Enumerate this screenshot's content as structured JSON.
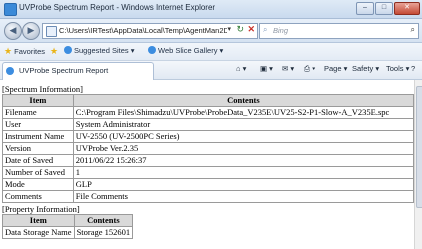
{
  "window": {
    "title": "UVProbe Spectrum Report - Windows Internet Explorer",
    "min_label": "–",
    "max_label": "□",
    "close_label": "✕"
  },
  "address": {
    "url": "C:\\Users\\IRTest\\AppData\\Local\\Temp\\AgentMan2D",
    "search_placeholder": "Bing"
  },
  "favorites_bar": {
    "favorites_label": "Favorites",
    "suggested_sites_label": "Suggested Sites ▾",
    "web_slice_label": "Web Slice Gallery ▾"
  },
  "tab": {
    "label": "UVProbe Spectrum Report"
  },
  "commands": {
    "page_label": "Page ▾",
    "safety_label": "Safety ▾",
    "tools_label": "Tools ▾"
  },
  "spectrum_info": {
    "section_title": "[Spectrum Information]",
    "headers": [
      "Item",
      "Contents"
    ],
    "rows": [
      [
        "Filename",
        "C:\\Program Files\\Shimadzu\\UVProbe\\ProbeData_V235E\\UV25-S2-P1-Slow-A_V235E.spc"
      ],
      [
        "User",
        "System Administrator"
      ],
      [
        "Instrument Name",
        "UV-2550 (UV-2500PC Series)"
      ],
      [
        "Version",
        "UVProbe Ver.2.35"
      ],
      [
        "Date of Saved",
        "2011/06/22 15:26:37"
      ],
      [
        "Number of Saved",
        "1"
      ],
      [
        "Mode",
        "GLP"
      ],
      [
        "Comments",
        "File Comments"
      ]
    ]
  },
  "property_info": {
    "section_title": "[Property Information]",
    "headers": [
      "Item",
      "Contents"
    ],
    "rows": [
      [
        "Data Storage Name",
        "Storage 152601"
      ]
    ]
  }
}
